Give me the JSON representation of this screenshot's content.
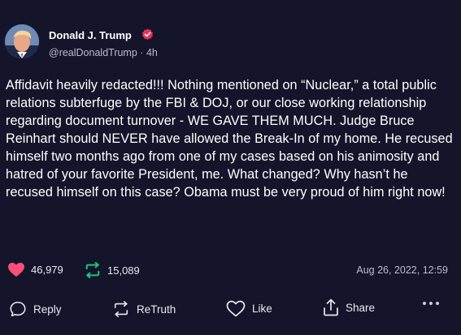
{
  "post": {
    "author": {
      "display_name": "Donald J. Trump",
      "handle": "@realDonaldTrump",
      "separator": "·",
      "age": "4h",
      "verified_icon": "verified-badge-icon"
    },
    "text": "Affidavit heavily redacted!!! Nothing mentioned on “Nuclear,” a total public relations subterfuge by the FBI & DOJ, or our close working relationship regarding document turnover - WE GAVE THEM MUCH. Judge Bruce Reinhart should NEVER have allowed the Break-In of my home. He recused himself two months ago from one of my cases based on his animosity and hatred of your favorite President, me. What changed? Why hasn’t he recused himself on this case? Obama must be very proud of him right now!",
    "stats": {
      "likes": "46,979",
      "retruths": "15,089"
    },
    "timestamp": "Aug 26, 2022, 12:59"
  },
  "actions": {
    "reply_label": "Reply",
    "retruth_label": "ReTruth",
    "like_label": "Like",
    "share_label": "Share"
  },
  "colors": {
    "background": "#14152b",
    "like": "#ff4d7a",
    "retruth": "#1fc47a",
    "verified": "#e5335c"
  }
}
